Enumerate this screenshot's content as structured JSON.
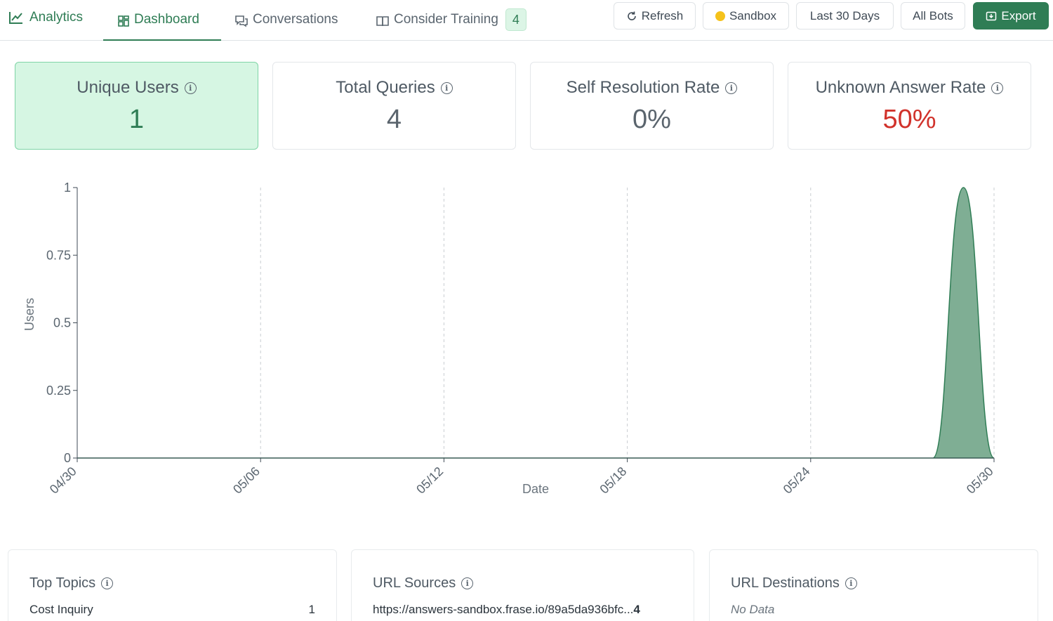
{
  "header": {
    "brand": "Analytics",
    "tabs": [
      {
        "label": "Dashboard",
        "active": true
      },
      {
        "label": "Conversations",
        "active": false
      },
      {
        "label": "Consider Training",
        "badge": "4",
        "active": false
      }
    ],
    "buttons": {
      "refresh": "Refresh",
      "environment": "Sandbox",
      "range": "Last 30 Days",
      "bots": "All Bots",
      "export": "Export"
    }
  },
  "stats": [
    {
      "title": "Unique Users",
      "value": "1"
    },
    {
      "title": "Total Queries",
      "value": "4"
    },
    {
      "title": "Self Resolution Rate",
      "value": "0%"
    },
    {
      "title": "Unknown Answer Rate",
      "value": "50%"
    }
  ],
  "colors": {
    "accent": "#2f7d55",
    "area_fill": "#7fae94",
    "danger": "#d1322b",
    "active_card": "#d6f6e3"
  },
  "chart_data": {
    "type": "area",
    "xlabel": "Date",
    "ylabel": "Users",
    "x_ticks": [
      "04/30",
      "05/06",
      "05/12",
      "05/18",
      "05/24",
      "05/30"
    ],
    "y_ticks": [
      "0",
      "0.25",
      "0.5",
      "0.75",
      "1"
    ],
    "ylim": [
      0,
      1
    ],
    "xlim": [
      "04/30",
      "05/30"
    ],
    "grid": "vertical dashed",
    "series": [
      {
        "x": [
          "04/30",
          "05/01",
          "05/02",
          "05/03",
          "05/04",
          "05/05",
          "05/06",
          "05/07",
          "05/08",
          "05/09",
          "05/10",
          "05/11",
          "05/12",
          "05/13",
          "05/14",
          "05/15",
          "05/16",
          "05/17",
          "05/18",
          "05/19",
          "05/20",
          "05/21",
          "05/22",
          "05/23",
          "05/24",
          "05/25",
          "05/26",
          "05/27",
          "05/28",
          "05/29",
          "05/30"
        ],
        "values": [
          0,
          0,
          0,
          0,
          0,
          0,
          0,
          0,
          0,
          0,
          0,
          0,
          0,
          0,
          0,
          0,
          0,
          0,
          0,
          0,
          0,
          0,
          0,
          0,
          0,
          0,
          0,
          0,
          0,
          1,
          0
        ]
      }
    ]
  },
  "panels": {
    "top_topics": {
      "title": "Top Topics",
      "rows": [
        {
          "label": "Cost Inquiry",
          "count": "1"
        }
      ]
    },
    "url_sources": {
      "title": "URL Sources",
      "rows": [
        {
          "label": "https://answers-sandbox.frase.io/89a5da936bfc...",
          "count": "4"
        }
      ]
    },
    "url_destinations": {
      "title": "URL Destinations",
      "empty": "No Data"
    }
  }
}
